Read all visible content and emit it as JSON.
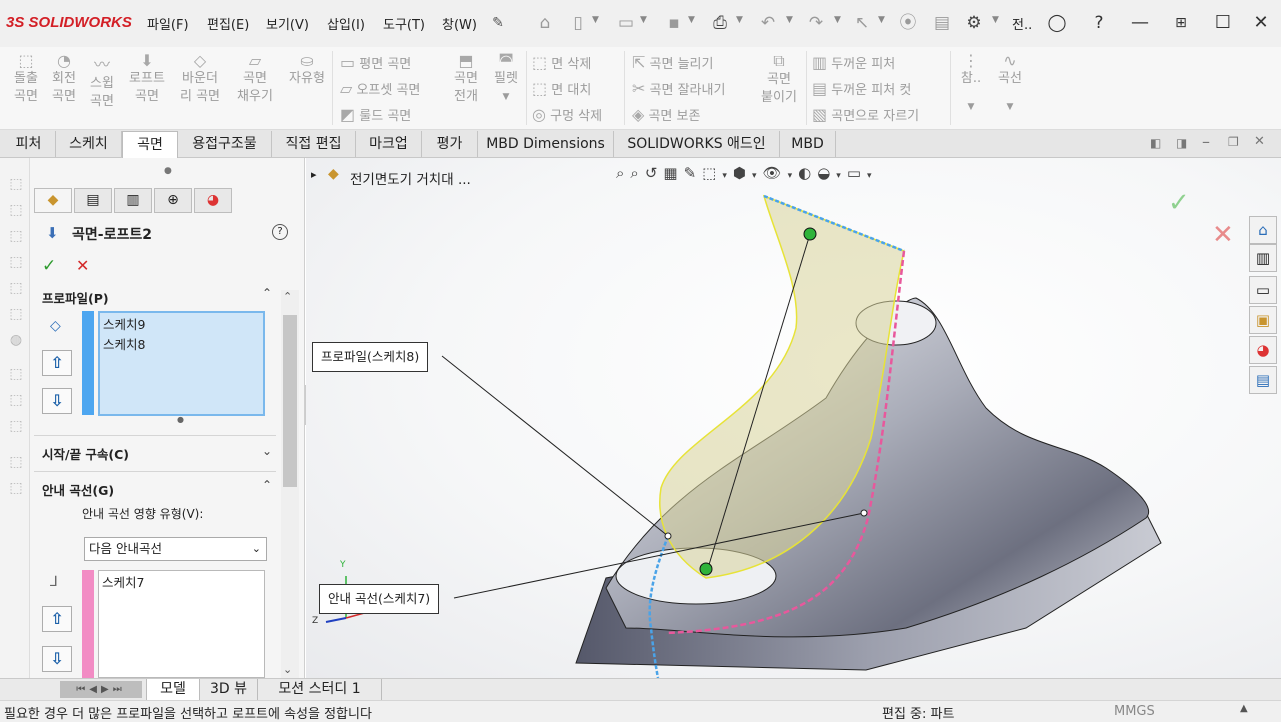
{
  "app": {
    "logo_text": "SOLIDWORKS",
    "logo_prefix": "3S"
  },
  "menu": [
    "파일(F)",
    "편집(E)",
    "보기(V)",
    "삽입(I)",
    "도구(T)",
    "창(W)"
  ],
  "title_truncated": "전..",
  "ribbon": {
    "group1": [
      {
        "line1": "돌출",
        "line2": "곡면"
      },
      {
        "line1": "회전",
        "line2": "곡면"
      },
      {
        "line1": "스윕",
        "line2": "곡면"
      },
      {
        "line1": "로프트",
        "line2": "곡면"
      },
      {
        "line1": "바운더",
        "line2": "리 곡면"
      },
      {
        "line1": "곡면",
        "line2": "채우기"
      },
      {
        "line1": "자유형",
        "line2": ""
      }
    ],
    "group2_rows": [
      "평면 곡면",
      "오프셋 곡면",
      "룰드 곡면"
    ],
    "group2_big": {
      "line1": "곡면",
      "line2": "전개"
    },
    "group2_fillet": "필렛",
    "group3_rows": [
      "면 삭제",
      "면 대치",
      "구멍 삭제"
    ],
    "group4_rows": [
      "곡면 늘리기",
      "곡면 잘라내기",
      "곡면 보존"
    ],
    "group4_big": {
      "line1": "곡면",
      "line2": "붙이기"
    },
    "group5_rows": [
      "두꺼운 피처",
      "두꺼운 피처 컷",
      "곡면으로 자르기"
    ],
    "group6": [
      {
        "line1": "참..",
        "line2": ""
      },
      {
        "line1": "곡선",
        "line2": ""
      }
    ]
  },
  "tabs": [
    "피처",
    "스케치",
    "곡면",
    "용접구조물",
    "직접 편집",
    "마크업",
    "평가",
    "MBD Dimensions",
    "SOLIDWORKS 애드인",
    "MBD"
  ],
  "active_tab": "곡면",
  "property_manager": {
    "title": "곡면-로프트2",
    "help_icon": "?",
    "ok_icon": "✓",
    "cancel_icon": "✕",
    "profile_section": "프로파일(P)",
    "profiles": [
      "스케치9",
      "스케치8"
    ],
    "start_end_section": "시작/끝 구속(C)",
    "guide_section": "안내 곡선(G)",
    "guide_influence_label": "안내 곡선 영향 유형(V):",
    "guide_influence_value": "다음 안내곡선",
    "guide_curves": [
      "스케치7"
    ]
  },
  "viewport": {
    "tree_label": "전기면도기 거치대 ...",
    "callout_profile": "프로파일(스케치8)",
    "callout_guide": "안내 곡선(스케치7)",
    "axis_y": "Y",
    "axis_z": "Z"
  },
  "bottom_tabs": [
    "모델",
    "3D 뷰",
    "모션 스터디 1"
  ],
  "active_bottom_tab": "모델",
  "status": {
    "message": "필요한 경우 더 많은 프로파일을 선택하고 로프트에 속성을 정합니다",
    "mode": "편집 중: 파트",
    "units": "MMGS"
  },
  "colors": {
    "accent_red": "#d31f26",
    "profile_bar": "#4da6f0",
    "guide_bar": "#f28cc4",
    "ok_green": "#2e9b2e",
    "cancel_red": "#d42a2a"
  }
}
